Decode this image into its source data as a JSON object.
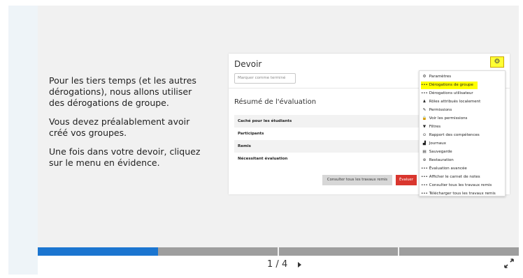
{
  "slide": {
    "paragraphs": [
      "Pour les tiers temps (et les autres dérogations), nous allons utiliser des dérogations de groupe.",
      "Vous devez préalablement avoir créé vos groupes.",
      "Une fois dans votre devoir, cliquez sur le menu en évidence."
    ]
  },
  "screenshot": {
    "title": "Devoir",
    "mark_done_placeholder": "Marquer comme terminé",
    "summary_title": "Résumé de l'évaluation",
    "summary_rows": [
      "Caché pour les étudiants",
      "Participants",
      "Remis",
      "Nécessitant évaluation"
    ],
    "btn_consult": "Consulter tous les travaux remis",
    "btn_eval": "Évaluer",
    "menu_items": [
      {
        "label": "Paramètres",
        "icon": "⚙",
        "highlight": false
      },
      {
        "label": "Dérogations de groupe",
        "icon": "•••",
        "highlight": true
      },
      {
        "label": "Dérogations utilisateur",
        "icon": "•••",
        "highlight": false
      },
      {
        "label": "Rôles attribués localement",
        "icon": "♟",
        "highlight": false
      },
      {
        "label": "Permissions",
        "icon": "✎",
        "highlight": false
      },
      {
        "label": "Voir les permissions",
        "icon": "🔒",
        "highlight": false
      },
      {
        "label": "Filtres",
        "icon": "▼",
        "highlight": false
      },
      {
        "label": "Rapport des compétences",
        "icon": "⊙",
        "highlight": false
      },
      {
        "label": "Journaux",
        "icon": "▟",
        "highlight": false
      },
      {
        "label": "Sauvegarde",
        "icon": "▤",
        "highlight": false
      },
      {
        "label": "Restauration",
        "icon": "⊛",
        "highlight": false
      },
      {
        "label": "Évaluation avancée",
        "icon": "•••",
        "highlight": false
      },
      {
        "label": "Afficher le carnet de notes",
        "icon": "•••",
        "highlight": false
      },
      {
        "label": "Consulter tous les travaux remis",
        "icon": "•••",
        "highlight": false
      },
      {
        "label": "Télécharger tous les travaux remis",
        "icon": "•••",
        "highlight": false
      }
    ]
  },
  "player": {
    "progress_fraction": 0.25,
    "page_current": "1",
    "page_total": "4",
    "page_separator": "/",
    "accent_color": "#1b75d0"
  }
}
